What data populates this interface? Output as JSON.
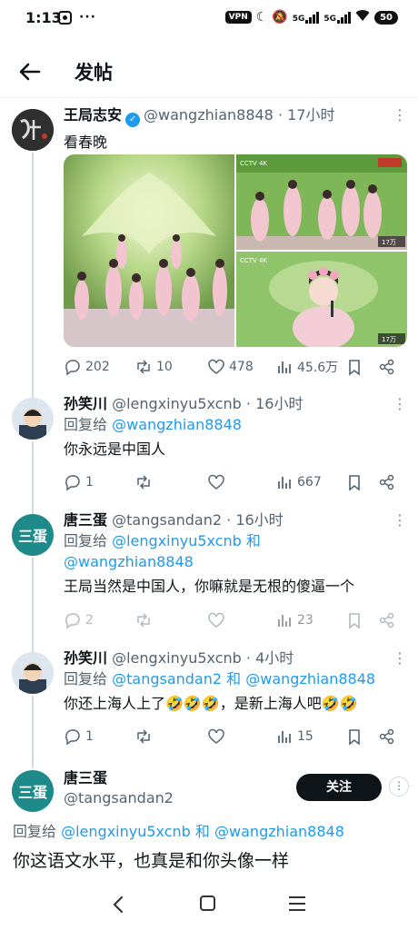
{
  "status_bar": {
    "time": "1:13",
    "vpn": "VPN",
    "signal1": "5G",
    "signal2": "5G",
    "battery": "50"
  },
  "header": {
    "title": "发帖"
  },
  "posts": [
    {
      "name": "王局志安",
      "handle": "@wangzhian8848",
      "time": "17小时",
      "verified": true,
      "text": "看春晚",
      "stats": {
        "replies": "202",
        "reposts": "10",
        "likes": "478",
        "views": "45.6万"
      },
      "media": {
        "tl_caption": "",
        "tr_logo": "CCTV 4K",
        "tr_badge": "17万",
        "br_logo": "CCTV 4K",
        "br_badge": "17万"
      }
    },
    {
      "name": "孙笑川",
      "handle": "@lengxinyu5xcnb",
      "time": "16小时",
      "reply_prefix": "回复给",
      "reply_to": "@wangzhian8848",
      "reply_and": "",
      "reply_to2": "",
      "text": "你永远是中国人",
      "stats": {
        "replies": "1",
        "reposts": "",
        "likes": "",
        "views": "667"
      }
    },
    {
      "name": "唐三蛋",
      "avatar_text": "三蛋",
      "handle": "@tangsandan2",
      "time": "16小时",
      "reply_prefix": "回复给",
      "reply_to": "@lengxinyu5xcnb",
      "reply_and": "和",
      "reply_to2": "@wangzhian8848",
      "text": "王局当然是中国人，你嘛就是无根的傻逼一个",
      "stats": {
        "replies": "2",
        "reposts": "",
        "likes": "",
        "views": "23"
      }
    },
    {
      "name": "孙笑川",
      "handle": "@lengxinyu5xcnb",
      "time": "4小时",
      "reply_prefix": "回复给",
      "reply_to": "@tangsandan2",
      "reply_and": "和",
      "reply_to2": "@wangzhian8848",
      "text": "你还上海人上了🤣🤣🤣，是新上海人吧🤣🤣",
      "stats": {
        "replies": "1",
        "reposts": "",
        "likes": "",
        "views": "15"
      }
    },
    {
      "name": "唐三蛋",
      "avatar_text": "三蛋",
      "handle": "@tangsandan2",
      "follow_label": "关注",
      "reply_prefix": "回复给",
      "reply_to": "@lengxinyu5xcnb",
      "reply_and": "和",
      "reply_to2": "@wangzhian8848",
      "text": "你这语文水平，也真是和你头像一样"
    }
  ],
  "colors": {
    "accent": "#1d9bf0",
    "text": "#0f1419",
    "muted": "#536471",
    "thread": "#cfd9de"
  }
}
